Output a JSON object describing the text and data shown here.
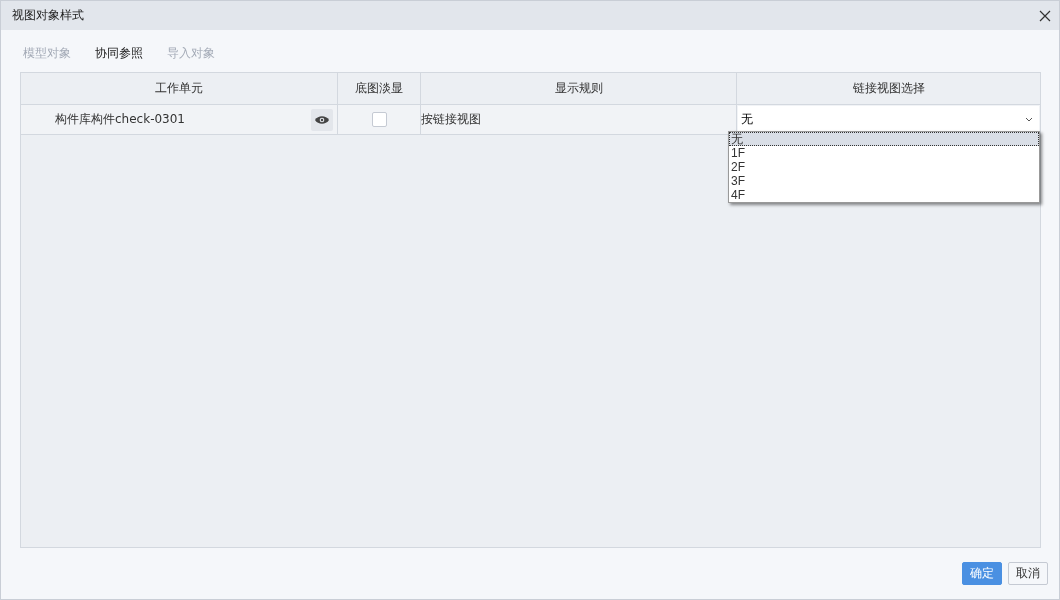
{
  "window": {
    "title": "视图对象样式"
  },
  "tabs": [
    {
      "label": "模型对象",
      "selected": false
    },
    {
      "label": "协同参照",
      "selected": true
    },
    {
      "label": "导入对象",
      "selected": false
    }
  ],
  "table": {
    "columns": [
      "工作单元",
      "底图淡显",
      "显示规则",
      "链接视图选择"
    ],
    "rows": [
      {
        "work_unit": "构件库构件check-0301",
        "dim_base": false,
        "display_rule": "按链接视图",
        "link_view": "无"
      }
    ]
  },
  "dropdown": {
    "options": [
      {
        "label": "无",
        "selected": true
      },
      {
        "label": "1F",
        "selected": false
      },
      {
        "label": "2F",
        "selected": false
      },
      {
        "label": "3F",
        "selected": false
      },
      {
        "label": "4F",
        "selected": false
      }
    ]
  },
  "buttons": [
    {
      "label": "确定",
      "kind": "primary"
    },
    {
      "label": "取消",
      "kind": "default"
    }
  ]
}
